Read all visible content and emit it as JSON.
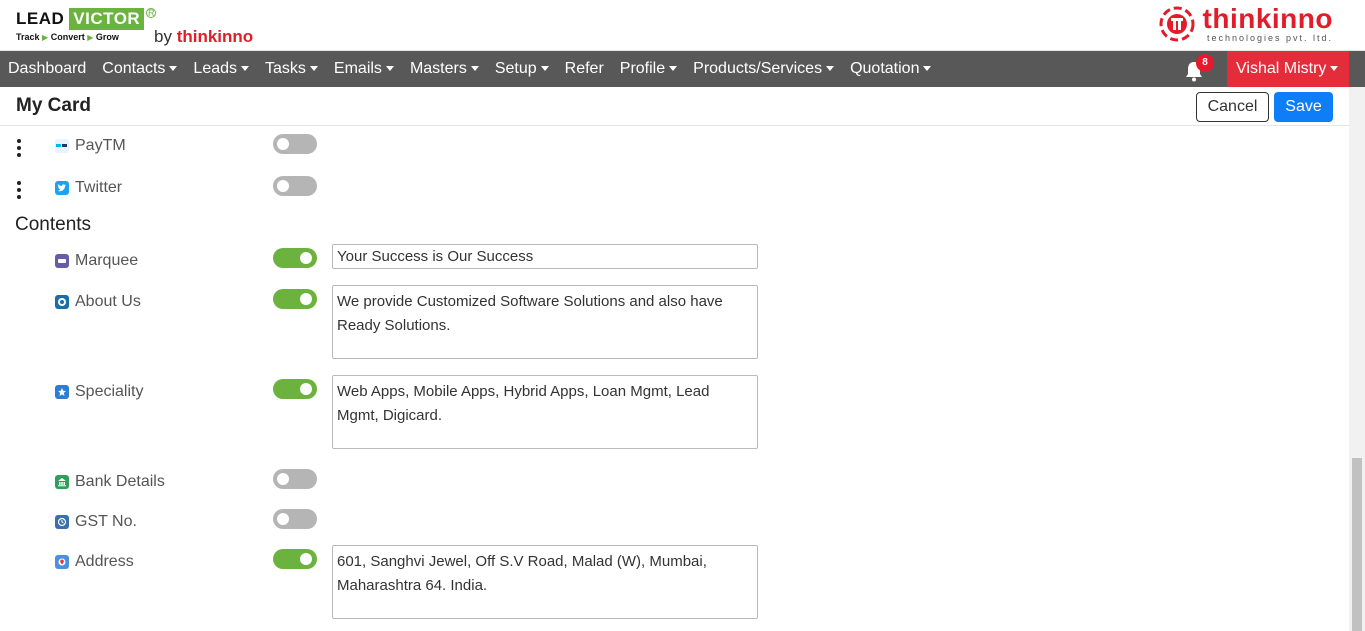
{
  "header": {
    "logo_lead": "LEAD",
    "logo_victor": "VICTOR",
    "logo_tagline": [
      "Track",
      "Convert",
      "Grow"
    ],
    "by_text": "by",
    "by_brand": "thinkinno",
    "company_name": "thinkinno",
    "company_sub": "technologies pvt. ltd."
  },
  "nav": {
    "items": [
      {
        "label": "Dashboard",
        "dropdown": false
      },
      {
        "label": "Contacts",
        "dropdown": true
      },
      {
        "label": "Leads",
        "dropdown": true
      },
      {
        "label": "Tasks",
        "dropdown": true
      },
      {
        "label": "Emails",
        "dropdown": true
      },
      {
        "label": "Masters",
        "dropdown": true
      },
      {
        "label": "Setup",
        "dropdown": true
      },
      {
        "label": "Refer",
        "dropdown": false
      },
      {
        "label": "Profile",
        "dropdown": true
      },
      {
        "label": "Products/Services",
        "dropdown": true
      },
      {
        "label": "Quotation",
        "dropdown": true
      }
    ],
    "notification_count": "8",
    "user_name": "Vishal Mistry"
  },
  "page": {
    "title": "My Card",
    "cancel_label": "Cancel",
    "save_label": "Save"
  },
  "social": [
    {
      "label": "PayTM",
      "icon": "paytm-icon",
      "enabled": false
    },
    {
      "label": "Twitter",
      "icon": "twitter-icon",
      "enabled": false
    }
  ],
  "contents": {
    "title": "Contents",
    "items": [
      {
        "label": "Marquee",
        "icon": "marquee-icon",
        "enabled": true,
        "value": "Your Success is Our Success"
      },
      {
        "label": "About Us",
        "icon": "about-us-icon",
        "enabled": true,
        "value": "We provide Customized Software Solutions and also have Ready Solutions."
      },
      {
        "label": "Speciality",
        "icon": "speciality-icon",
        "enabled": true,
        "value": "Web Apps, Mobile Apps, Hybrid Apps, Loan Mgmt, Lead Mgmt, Digicard."
      },
      {
        "label": "Bank Details",
        "icon": "bank-icon",
        "enabled": false
      },
      {
        "label": "GST No.",
        "icon": "gst-icon",
        "enabled": false
      },
      {
        "label": "Address",
        "icon": "address-icon",
        "enabled": true,
        "value": "601,  Sanghvi Jewel, Off S.V Road, Malad (W), Mumbai, Maharashtra 64. India."
      }
    ]
  },
  "colors": {
    "nav_bg": "#585858",
    "user_bg": "#e52c3a",
    "toggle_on": "#6bb33e",
    "toggle_off": "#b5b5b5",
    "save_bg": "#0d7ef5",
    "brand_red": "#e11d2a"
  }
}
